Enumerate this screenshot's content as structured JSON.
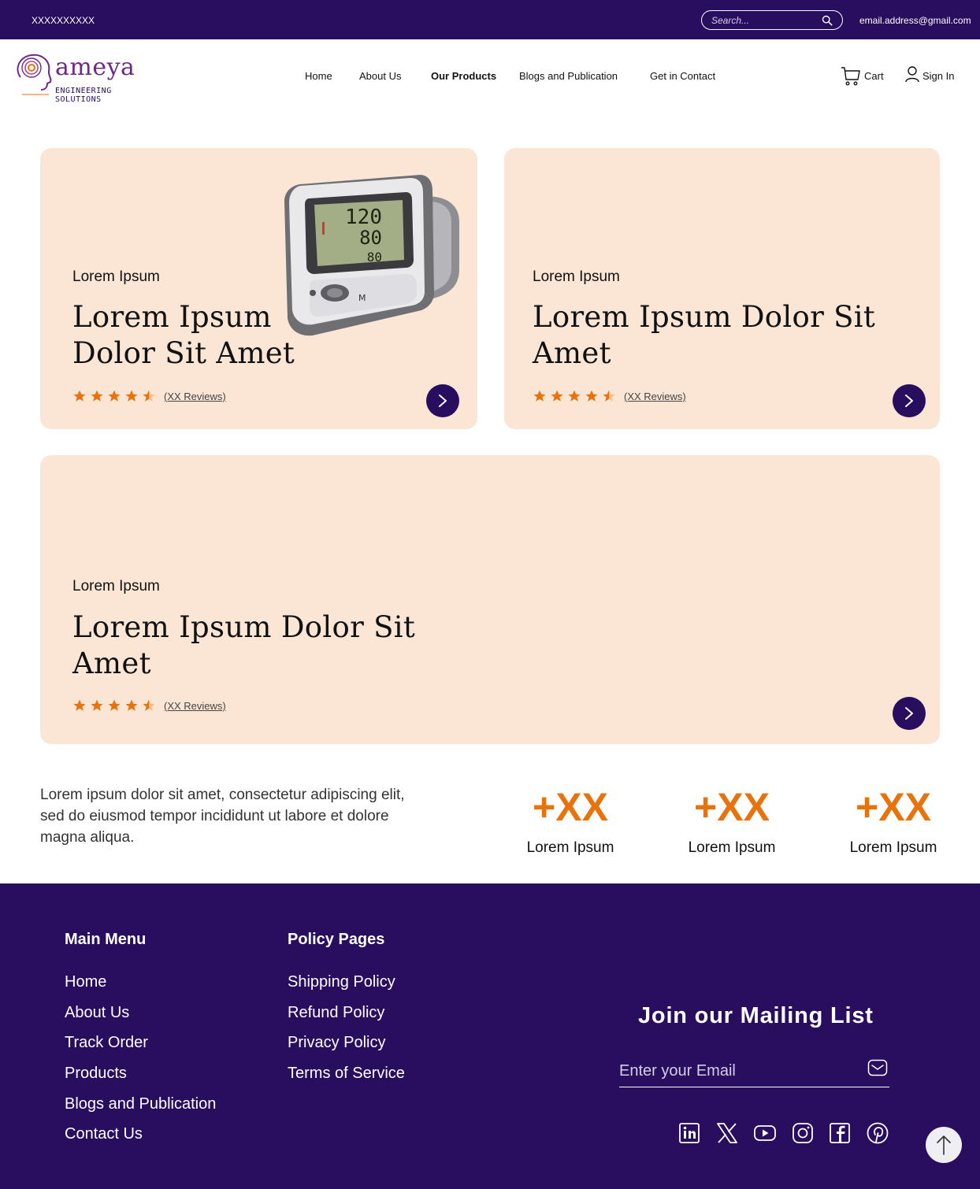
{
  "topbar": {
    "phone": "XXXXXXXXXX",
    "search_placeholder": "Search...",
    "email": "email.address@gmail.com"
  },
  "logo": {
    "word": "ameya",
    "tagline": "ENGINEERING SOLUTIONS"
  },
  "nav": {
    "items": [
      {
        "label": "Home"
      },
      {
        "label": "About Us"
      },
      {
        "label": "Our Products",
        "active": true
      },
      {
        "label": "Blogs and Publication"
      },
      {
        "label": "Get in Contact"
      }
    ],
    "cart": "Cart",
    "signin": "Sign In"
  },
  "cards": [
    {
      "kicker": "Lorem Ipsum",
      "title_line1": "Lorem Ipsum",
      "title_line2": "Dolor Sit Amet",
      "reviews": "(XX Reviews)",
      "rating": 4.5,
      "device_readings": [
        "120",
        "80",
        "80"
      ]
    },
    {
      "kicker": "Lorem Ipsum",
      "title_line1": "Lorem Ipsum Dolor Sit",
      "title_line2": "Amet",
      "reviews": "(XX Reviews)",
      "rating": 4.5
    },
    {
      "kicker": "Lorem Ipsum",
      "title_line1": "Lorem Ipsum Dolor Sit",
      "title_line2": "Amet",
      "reviews": "(XX Reviews)",
      "rating": 4.5
    }
  ],
  "about_text": "Lorem ipsum dolor sit amet, consectetur adipiscing elit, sed do eiusmod tempor incididunt ut labore et dolore magna aliqua.",
  "stats": [
    {
      "value": "+XX",
      "label": "Lorem Ipsum"
    },
    {
      "value": "+XX",
      "label": "Lorem Ipsum"
    },
    {
      "value": "+XX",
      "label": "Lorem Ipsum"
    }
  ],
  "footer": {
    "main_menu_title": "Main Menu",
    "main_menu": [
      "Home",
      "About Us",
      "Track Order",
      "Products",
      "Blogs and Publication",
      "Contact Us"
    ],
    "policy_title": "Policy Pages",
    "policy": [
      "Shipping Policy",
      "Refund Policy",
      "Privacy Policy",
      "Terms of Service"
    ],
    "mailing_title": "Join our Mailing List",
    "email_placeholder": "Enter your Email",
    "social": [
      "linkedin-icon",
      "x-icon",
      "youtube-icon",
      "instagram-icon",
      "facebook-icon",
      "pinterest-icon"
    ]
  },
  "colors": {
    "brand": "#290d5e",
    "accent": "#e8720c",
    "card_bg": "#fbe6d6"
  }
}
